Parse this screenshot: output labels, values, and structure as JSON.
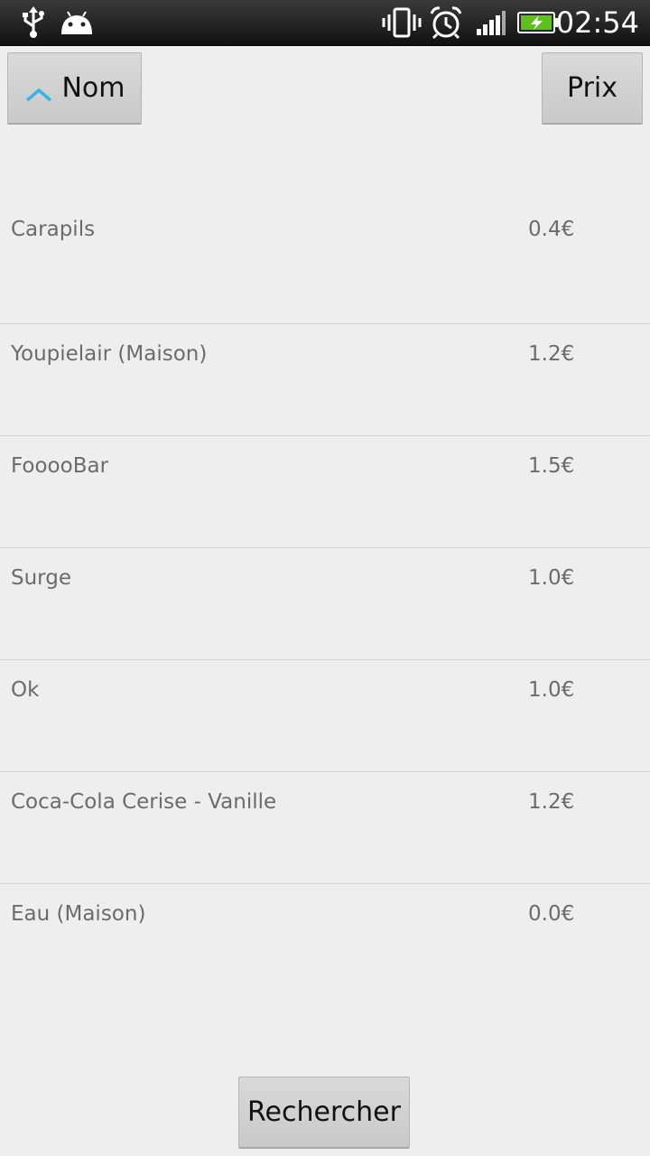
{
  "status_bar": {
    "time": "02:54",
    "icons": [
      "usb-icon",
      "android-debug-icon",
      "vibrate-icon",
      "alarm-icon",
      "signal-icon",
      "battery-charging-icon"
    ]
  },
  "sort_buttons": {
    "name_label": "Nom",
    "price_label": "Prix",
    "name_sort_direction": "ascending"
  },
  "items": [
    {
      "name": "Carapils",
      "price": "0.4€"
    },
    {
      "name": "Youpielair (Maison)",
      "price": "1.2€"
    },
    {
      "name": "FooooBar",
      "price": "1.5€"
    },
    {
      "name": "Surge",
      "price": "1.0€"
    },
    {
      "name": "Ok",
      "price": "1.0€"
    },
    {
      "name": "Coca-Cola Cerise - Vanille",
      "price": "1.2€"
    },
    {
      "name": "Eau (Maison)",
      "price": "0.0€"
    }
  ],
  "search_button": {
    "label": "Rechercher"
  },
  "colors": {
    "background": "#eeeeee",
    "accent": "#33b5e5",
    "text_secondary": "#6b6b6b",
    "divider": "#cfcfcf"
  }
}
